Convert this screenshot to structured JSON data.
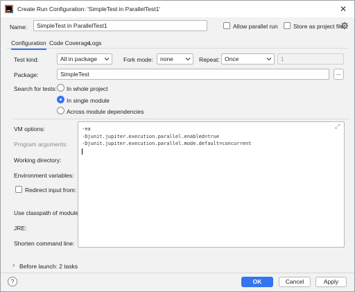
{
  "window": {
    "title": "Create Run Configuration: 'SimpleTest in ParallelTest1'",
    "close_glyph": "✕"
  },
  "header": {
    "name_label": "Name:",
    "name_value": "SimpleTest in ParallelTest1",
    "allow_parallel_label": "Allow parallel run",
    "store_project_label": "Store as project file"
  },
  "tabs": [
    {
      "label": "Configuration",
      "active": true
    },
    {
      "label": "Code Coverage",
      "active": false
    },
    {
      "label": "Logs",
      "active": false
    }
  ],
  "config": {
    "test_kind_label": "Test kind:",
    "test_kind_value": "All in package",
    "fork_mode_label": "Fork mode:",
    "fork_mode_value": "none",
    "repeat_label": "Repeat:",
    "repeat_value": "Once",
    "repeat_count": "1",
    "package_label": "Package:",
    "package_value": "SimpleTest",
    "browse_label": "...",
    "search_label": "Search for tests:",
    "search_options": [
      {
        "label": "In whole project",
        "selected": false
      },
      {
        "label": "In single module",
        "selected": true
      },
      {
        "label": "Across module dependencies",
        "selected": false
      }
    ]
  },
  "vm": {
    "vm_options_label": "VM options:",
    "program_args_label": "Program arguments:",
    "working_dir_label": "Working directory:",
    "env_vars_label": "Environment variables:",
    "redirect_label": "Redirect input from:",
    "classpath_label": "Use classpath of module:",
    "jre_label": "JRE:",
    "shorten_label": "Shorten command line:",
    "vm_option_lines": [
      "-ea",
      "-Djunit.jupiter.execution.parallel.enabled=true",
      "-Djunit.jupiter.execution.parallel.mode.default=concurrent"
    ],
    "expand_glyph": "⤢"
  },
  "before_launch": {
    "label": "Before launch: 2 tasks",
    "chevron_glyph": "›"
  },
  "footer": {
    "help_glyph": "?",
    "ok_label": "OK",
    "cancel_label": "Cancel",
    "apply_label": "Apply"
  },
  "colors": {
    "accent": "#3574f0",
    "background": "#f2f2f2"
  }
}
